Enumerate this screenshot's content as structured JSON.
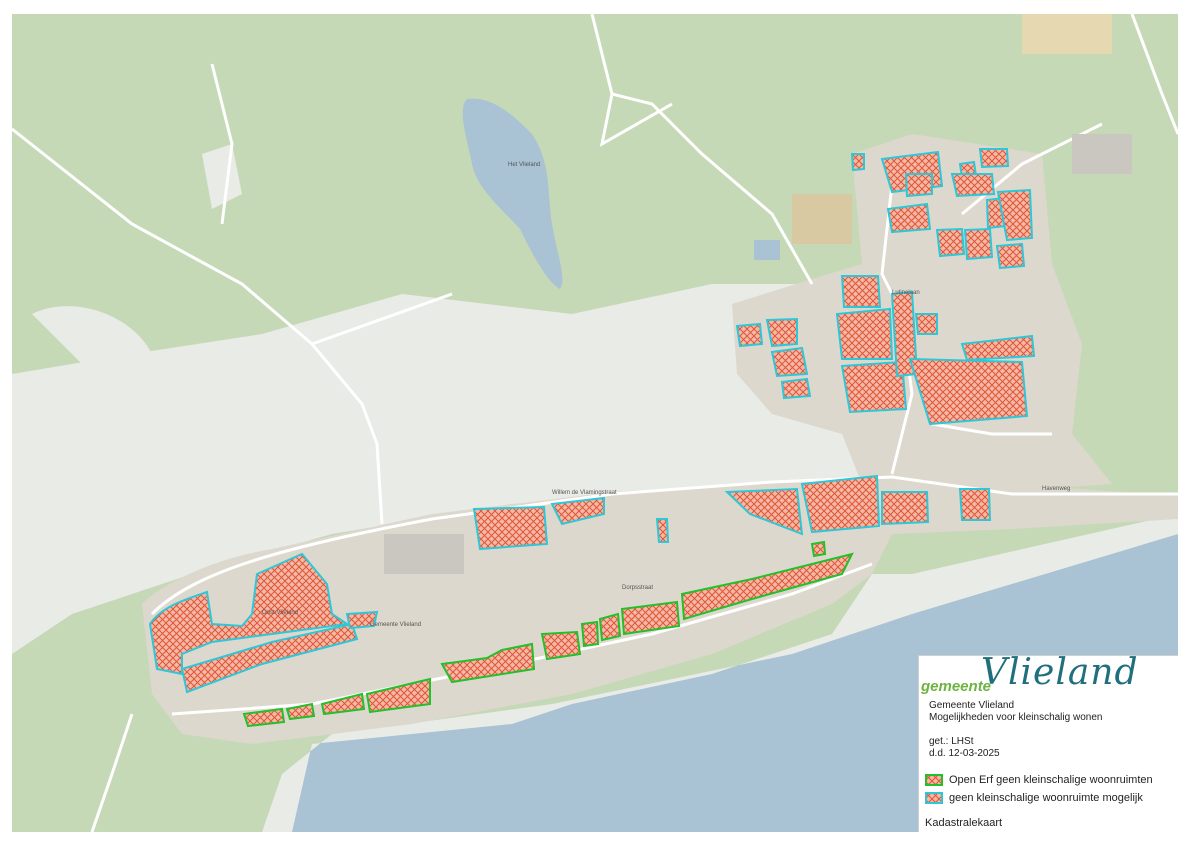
{
  "map": {
    "labels": {
      "lake": "Het Vlieland",
      "street_main": "Dorpsstraat",
      "street_1": "Willem de Vlamingstraat",
      "street_2": "Lutinelaan",
      "street_3": "Oost-Vlieland",
      "quay": "Havenweg",
      "center": "Gemeente Vlieland"
    },
    "colors": {
      "open_erf_outline": "#22c02b",
      "geen_outline": "#2ec7d8",
      "hatch": "#e05535",
      "hatch_fill": "#f4b8a6",
      "sea": "#a9c2d4",
      "forest": "#c6d9b7",
      "dune": "#e9ebe6",
      "built": "#dcd8cd"
    }
  },
  "legend": {
    "logo_word": "gemeente",
    "logo_script": "Vlieland",
    "org": "Gemeente Vlieland",
    "subtitle": "Mogelijkheden voor kleinschalig wonen",
    "drawn_by": "get.: LHSt",
    "date": "d.d. 12-03-2025",
    "items": [
      {
        "label": "Open Erf geen kleinschalige woonruimten",
        "outline": "#22c02b"
      },
      {
        "label": "geen kleinschalige woonruimte mogelijk",
        "outline": "#2ec7d8"
      }
    ],
    "base_layer": "Kadastralekaart"
  }
}
